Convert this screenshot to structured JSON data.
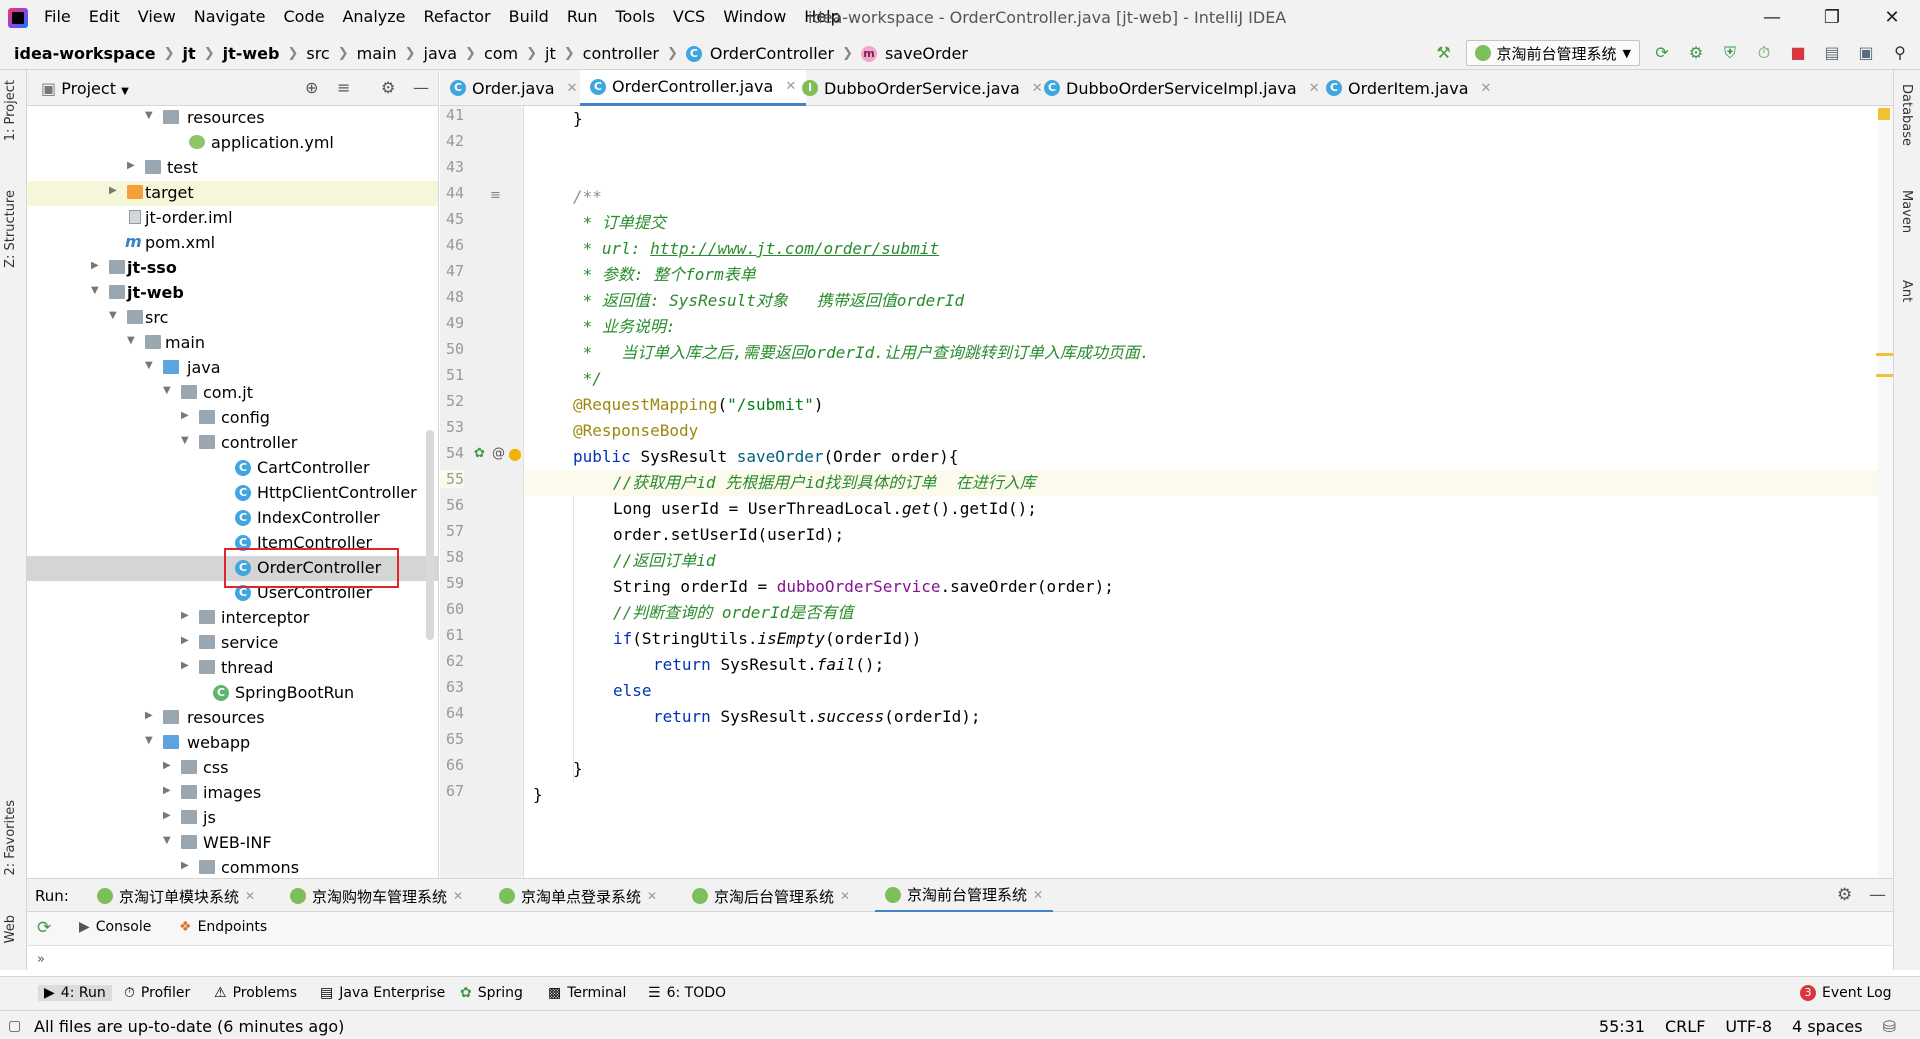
{
  "menubar": {
    "items": [
      "File",
      "Edit",
      "View",
      "Navigate",
      "Code",
      "Analyze",
      "Refactor",
      "Build",
      "Run",
      "Tools",
      "VCS",
      "Window",
      "Help"
    ],
    "title": "idea-workspace - OrderController.java [jt-web] - IntelliJ IDEA"
  },
  "navbar": {
    "crumbs": [
      "idea-workspace",
      "jt",
      "jt-web",
      "src",
      "main",
      "java",
      "com",
      "jt",
      "controller",
      "OrderController",
      "saveOrder"
    ],
    "run_config": "京淘前台管理系统"
  },
  "leftstrip": {
    "project": "1: Project",
    "structure": "Z: Structure",
    "favorites": "2: Favorites",
    "web": "Web"
  },
  "rightstrip": {
    "database": "Database",
    "maven": "Maven",
    "ant": "Ant"
  },
  "project": {
    "title": "Project",
    "tree": [
      {
        "label": "resources"
      },
      {
        "label": "application.yml"
      },
      {
        "label": "test"
      },
      {
        "label": "target"
      },
      {
        "label": "jt-order.iml"
      },
      {
        "label": "pom.xml"
      },
      {
        "label": "jt-sso"
      },
      {
        "label": "jt-web"
      },
      {
        "label": "src"
      },
      {
        "label": "main"
      },
      {
        "label": "java"
      },
      {
        "label": "com.jt"
      },
      {
        "label": "config"
      },
      {
        "label": "controller"
      },
      {
        "label": "CartController"
      },
      {
        "label": "HttpClientController"
      },
      {
        "label": "IndexController"
      },
      {
        "label": "ItemController"
      },
      {
        "label": "OrderController"
      },
      {
        "label": "UserController"
      },
      {
        "label": "interceptor"
      },
      {
        "label": "service"
      },
      {
        "label": "thread"
      },
      {
        "label": "SpringBootRun"
      },
      {
        "label": "resources"
      },
      {
        "label": "webapp"
      },
      {
        "label": "css"
      },
      {
        "label": "images"
      },
      {
        "label": "js"
      },
      {
        "label": "WEB-INF"
      },
      {
        "label": "commons"
      }
    ]
  },
  "editor": {
    "tabs": [
      "Order.java",
      "OrderController.java",
      "DubboOrderService.java",
      "DubboOrderServiceImpl.java",
      "OrderItem.java"
    ],
    "active_tab": "OrderController.java",
    "line_numbers": [
      "41",
      "42",
      "43",
      "44",
      "45",
      "46",
      "47",
      "48",
      "49",
      "50",
      "51",
      "52",
      "53",
      "54",
      "55",
      "56",
      "57",
      "58",
      "59",
      "60",
      "61",
      "62",
      "63",
      "64",
      "65",
      "66",
      "67"
    ],
    "code": {
      "l41": "}",
      "l44": "/**",
      "l45": " * 订单提交",
      "l46a": " * url: ",
      "l46b": "http://www.jt.com/order/submit",
      "l47": " * 参数: 整个form表单",
      "l48": " * 返回值: SysResult对象   携带返回值orderId",
      "l49": " * 业务说明:",
      "l50": " *   当订单入库之后,需要返回orderId.让用户查询跳转到订单入库成功页面.",
      "l51": " */",
      "l52a": "@RequestMapping",
      "l52b": "(",
      "l52c": "\"/submit\"",
      "l52d": ")",
      "l53": "@ResponseBody",
      "l54a": "public ",
      "l54b": "SysResult ",
      "l54c": "saveOrder",
      "l54d": "(Order order){",
      "l55": "//获取用户id 先根据用户id找到具体的订单  在进行入库",
      "l56a": "Long userId = UserThreadLocal.",
      "l56b": "get",
      "l56c": "().getId();",
      "l57": "order.setUserId(userId);",
      "l58": "//返回订单id",
      "l59a": "String orderId = ",
      "l59b": "dubboOrderService",
      "l59c": ".saveOrder(order);",
      "l60": "//判断查询的 orderId是否有值",
      "l61a": "if",
      "l61b": "(StringUtils.",
      "l61c": "isEmpty",
      "l61d": "(orderId))",
      "l62a": "return ",
      "l62b": "SysResult.",
      "l62c": "fail",
      "l62d": "();",
      "l63": "else",
      "l64a": "return ",
      "l64b": "SysResult.",
      "l64c": "success",
      "l64d": "(orderId);",
      "l66": "}",
      "l67": "}"
    }
  },
  "run": {
    "label": "Run:",
    "tabs": [
      "京淘订单模块系统",
      "京淘购物车管理系统",
      "京淘单点登录系统",
      "京淘后台管理系统",
      "京淘前台管理系统"
    ],
    "subtabs": [
      "Console",
      "Endpoints"
    ]
  },
  "bottom_tabs": [
    "4: Run",
    "Profiler",
    "Problems",
    "Java Enterprise",
    "Spring",
    "Terminal",
    "6: TODO"
  ],
  "event_log": {
    "label": "Event Log",
    "count": "3"
  },
  "status": {
    "message": "All files are up-to-date (6 minutes ago)",
    "position": "55:31",
    "line_sep": "CRLF",
    "encoding": "UTF-8",
    "indent": "4 spaces"
  }
}
